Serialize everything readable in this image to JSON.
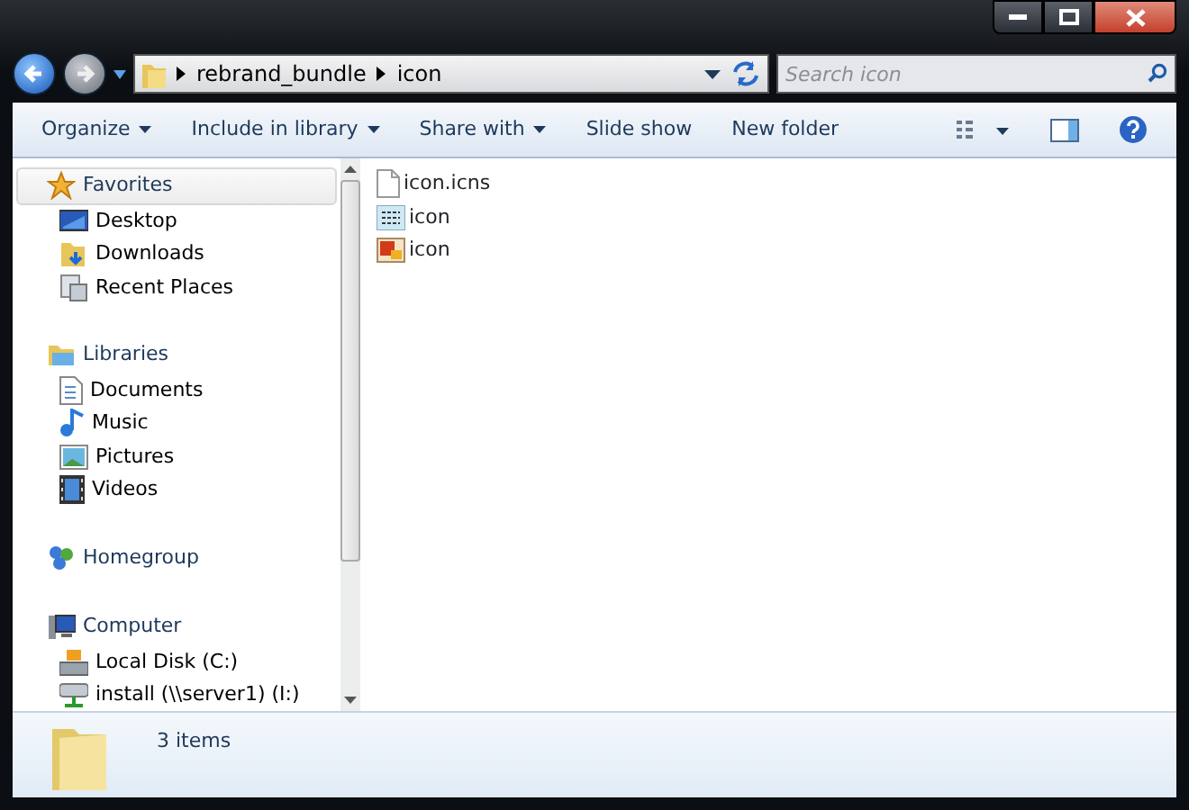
{
  "address_bar": {
    "path": [
      "rebrand_bundle",
      "icon"
    ]
  },
  "search": {
    "placeholder": "Search icon"
  },
  "toolbar": {
    "buttons": [
      {
        "label": "Organize",
        "dropdown": true
      },
      {
        "label": "Include in library",
        "dropdown": true
      },
      {
        "label": "Share with",
        "dropdown": true
      },
      {
        "label": "Slide show",
        "dropdown": false
      },
      {
        "label": "New folder",
        "dropdown": false
      }
    ]
  },
  "navigation_pane": {
    "groups": [
      {
        "label": "Favorites",
        "hovered": true,
        "items": [
          "Desktop",
          "Downloads",
          "Recent Places"
        ]
      },
      {
        "label": "Libraries",
        "hovered": false,
        "items": [
          "Documents",
          "Music",
          "Pictures",
          "Videos"
        ]
      },
      {
        "label": "Homegroup",
        "hovered": false
      },
      {
        "label": "Computer",
        "hovered": false,
        "items": [
          "Local Disk (C:)",
          "install (\\\\server1) (I:)"
        ]
      }
    ]
  },
  "files": [
    {
      "name": "icon.icns",
      "kind": "document"
    },
    {
      "name": "icon",
      "kind": "text-image"
    },
    {
      "name": "icon",
      "kind": "picture"
    }
  ],
  "status_bar": {
    "item_count": "3 items"
  }
}
